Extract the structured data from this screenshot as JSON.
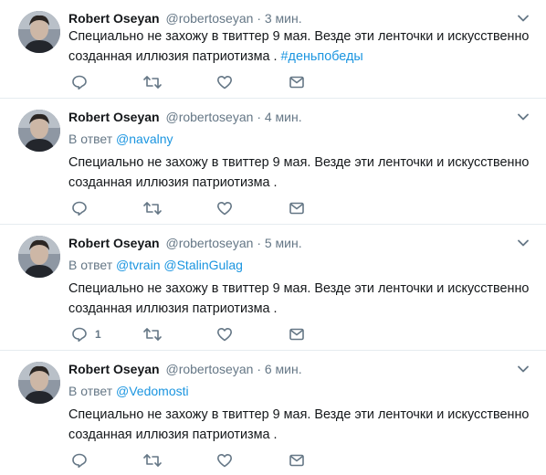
{
  "tweets": [
    {
      "author": "Robert Oseyan",
      "handle": "@robertoseyan",
      "separator": "·",
      "time": "3 мин.",
      "text": "Специально не захожу в твиттер 9 мая. Везде эти ленточки и искусственно созданная иллюзия патриотизма .",
      "hashtag": "#деньпобеды"
    },
    {
      "author": "Robert Oseyan",
      "handle": "@robertoseyan",
      "separator": "·",
      "time": "4 мин.",
      "reply_prefix": "В ответ",
      "reply_mentions": [
        "@navalny"
      ],
      "text": "Специально не захожу в твиттер 9 мая. Везде эти ленточки и искусственно созданная иллюзия патриотизма ."
    },
    {
      "author": "Robert Oseyan",
      "handle": "@robertoseyan",
      "separator": "·",
      "time": "5 мин.",
      "reply_prefix": "В ответ",
      "reply_mentions": [
        "@tvrain",
        "@StalinGulag"
      ],
      "text": "Специально не захожу в твиттер 9 мая. Везде эти ленточки и искусственно созданная иллюзия патриотизма .",
      "reply_count": "1"
    },
    {
      "author": "Robert Oseyan",
      "handle": "@robertoseyan",
      "separator": "·",
      "time": "6 мин.",
      "reply_prefix": "В ответ",
      "reply_mentions": [
        "@Vedomosti"
      ],
      "text": "Специально не захожу в твиттер 9 мая. Везде эти ленточки и искусственно созданная иллюзия патриотизма ."
    }
  ],
  "icons": {
    "reply": "reply-icon",
    "retweet": "retweet-icon",
    "like": "heart-icon",
    "dm": "envelope-icon",
    "more": "chevron-down-icon"
  },
  "colors": {
    "link": "#1b95e0",
    "muted": "#657786",
    "text": "#14171a",
    "divider": "#e6ecf0"
  }
}
